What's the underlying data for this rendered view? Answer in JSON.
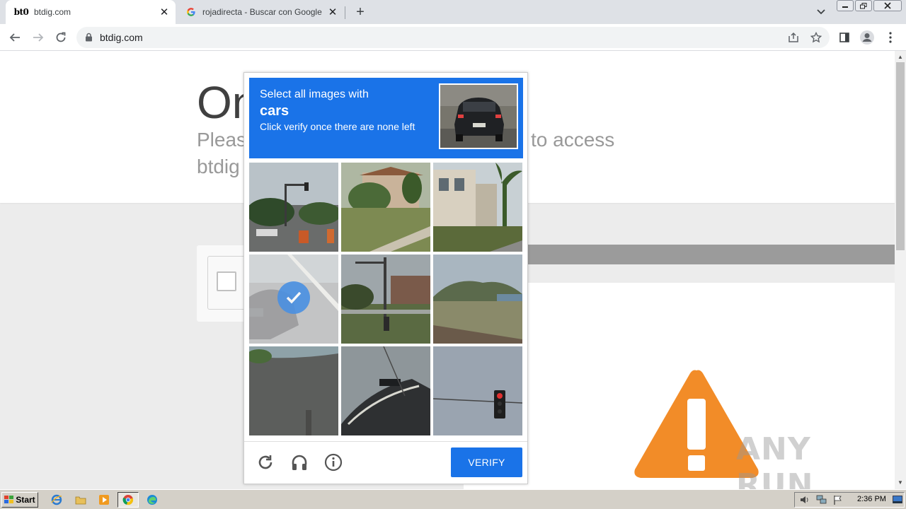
{
  "browser": {
    "tabs": [
      {
        "favicon_text": "bt0",
        "title": "btdig.com",
        "active": true
      },
      {
        "favicon_text": "G",
        "title": "rojadirecta - Buscar con Google",
        "active": false
      }
    ],
    "url": "btdig.com"
  },
  "page": {
    "heading": "On",
    "sub_left": "Pleas",
    "sub_right": "to access",
    "sub_line2": "btdig"
  },
  "captcha": {
    "prompt_line1": "Select all images with",
    "target": "cars",
    "prompt_line2": "Click verify once there are none left",
    "verify_label": "VERIFY",
    "selected_tiles": [
      3
    ],
    "tiles": [
      "intersection-traffic-light",
      "house-with-palm",
      "building-palm-tree",
      "car-selected",
      "street-pole-building",
      "hillside-road",
      "building-wall",
      "car-roof-closeup",
      "traffic-light-red"
    ]
  },
  "watermark": "ANY RUN",
  "taskbar": {
    "start_label": "Start",
    "clock": "2:36 PM"
  },
  "colors": {
    "captcha_blue": "#1a73e8",
    "warning_orange": "#f28c28"
  }
}
